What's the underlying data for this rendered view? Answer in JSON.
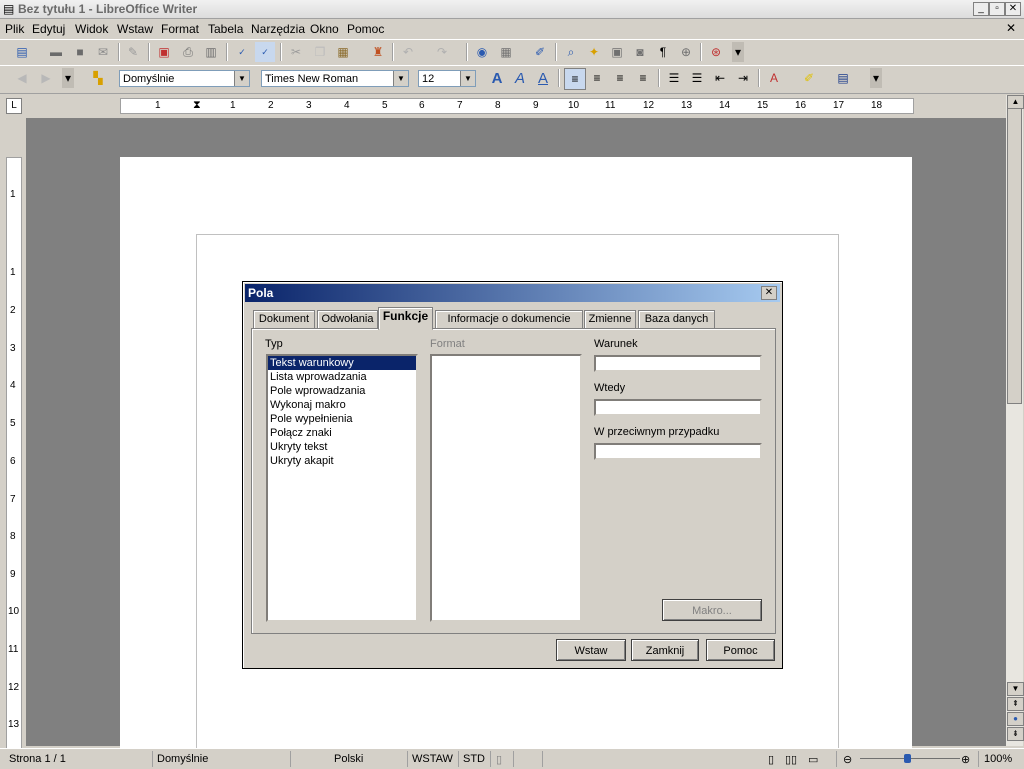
{
  "window": {
    "title": "Bez tytułu 1 - LibreOffice Writer",
    "min": "_",
    "max": "▫",
    "close": "✕",
    "doc_close": "✕"
  },
  "menu": [
    "Plik",
    "Edytuj",
    "Widok",
    "Wstaw",
    "Format",
    "Tabela",
    "Narzędzia",
    "Okno",
    "Pomoc"
  ],
  "format_bar": {
    "style": "Domyślnie",
    "font": "Times New Roman",
    "size": "12"
  },
  "ruler": {
    "ticks": [
      "1",
      "1",
      "2",
      "3",
      "4",
      "5",
      "6",
      "7",
      "8",
      "9",
      "10",
      "11",
      "12",
      "13",
      "14",
      "15",
      "16",
      "17",
      "18"
    ]
  },
  "vruler": {
    "ticks": [
      "1",
      "1",
      "2",
      "3",
      "4",
      "5",
      "6",
      "7",
      "8",
      "9",
      "10",
      "11",
      "12",
      "13"
    ]
  },
  "dialog": {
    "title": "Pola",
    "close": "✕",
    "tabs": [
      "Dokument",
      "Odwołania",
      "Funkcje",
      "Informacje o dokumencie",
      "Zmienne",
      "Baza danych"
    ],
    "active_tab": "Funkcje",
    "typ_label": "Typ",
    "format_label": "Format",
    "typ_items": [
      "Tekst warunkowy",
      "Lista wprowadzania",
      "Pole wprowadzania",
      "Wykonaj makro",
      "Pole wypełnienia",
      "Połącz znaki",
      "Ukryty tekst",
      "Ukryty akapit"
    ],
    "selected_typ": "Tekst warunkowy",
    "warunek_label": "Warunek",
    "warunek_value": "",
    "wtedy_label": "Wtedy",
    "wtedy_value": "",
    "wprzeciwnym_label": "W przeciwnym przypadku",
    "wprzeciwnym_value": "",
    "makro_button": "Makro...",
    "buttons": {
      "insert": "Wstaw",
      "close": "Zamknij",
      "help": "Pomoc"
    }
  },
  "status": {
    "page": "Strona 1 / 1",
    "style": "Domyślnie",
    "language": "Polski",
    "insert_mode": "WSTAW",
    "selection_mode": "STD",
    "zoom": "100%"
  }
}
